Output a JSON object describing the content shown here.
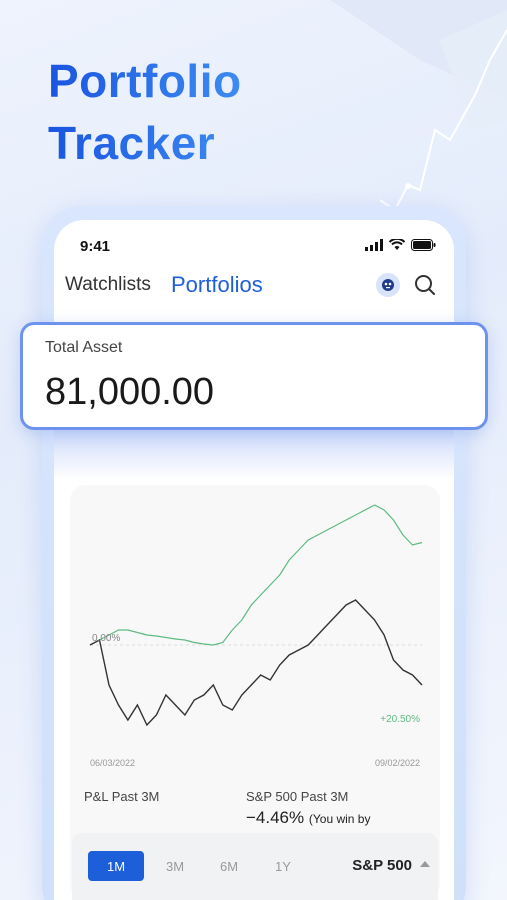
{
  "headline": {
    "line1": "Portfolio",
    "line2": "Tracker"
  },
  "status": {
    "time": "9:41"
  },
  "nav": {
    "tabs": [
      "Watchlists",
      "Portfolios"
    ],
    "active_tab": "Portfolios"
  },
  "total_asset": {
    "label": "Total Asset",
    "value": "81,000.00"
  },
  "chart_data": {
    "type": "line",
    "x_start": "06/03/2022",
    "x_end": "09/02/2022",
    "labels": {
      "zero": "0.00%",
      "end": "+20.50%"
    },
    "series": [
      {
        "color": "#5fba82",
        "values": [
          0,
          1,
          2,
          3,
          3,
          2.5,
          2,
          1.8,
          1.5,
          1.2,
          1,
          0.5,
          0.2,
          0,
          0.5,
          3,
          5,
          8,
          10,
          12,
          14,
          17,
          19,
          21,
          22,
          23,
          24,
          25,
          26,
          27,
          28,
          27,
          25,
          22,
          20,
          20.5
        ]
      },
      {
        "color": "#333333",
        "values": [
          0,
          1,
          -8,
          -12,
          -15,
          -12,
          -16,
          -14,
          -10,
          -12,
          -14,
          -11,
          -10,
          -8,
          -12,
          -13,
          -10,
          -8,
          -6,
          -7,
          -4,
          -2,
          -1,
          0,
          2,
          4,
          6,
          8,
          9,
          7,
          5,
          2,
          -3,
          -5,
          -6,
          -8
        ]
      }
    ]
  },
  "stats": {
    "pl_label": "P&L Past 3M",
    "bench_label": "S&P 500 Past 3M",
    "bench_value": "−4.46%",
    "bench_note": "(You win by"
  },
  "ranges": [
    "1M",
    "3M",
    "6M",
    "1Y"
  ],
  "active_range": "1M",
  "benchmark": "S&P 500"
}
